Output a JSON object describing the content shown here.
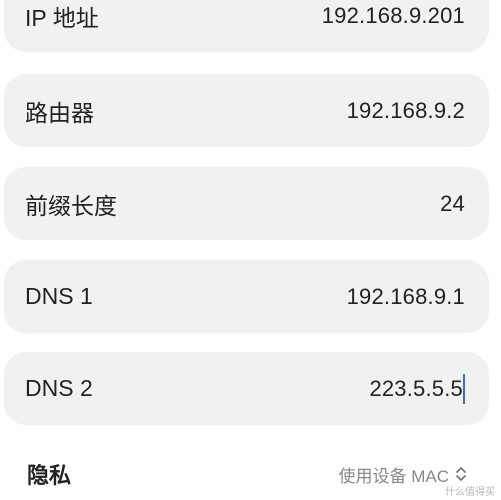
{
  "fields": [
    {
      "label": "IP 地址",
      "value": "192.168.9.201"
    },
    {
      "label": "路由器",
      "value": "192.168.9.2"
    },
    {
      "label": "前缀长度",
      "value": "24"
    },
    {
      "label": "DNS 1",
      "value": "192.168.9.1"
    },
    {
      "label": "DNS 2",
      "value": "223.5.5.5"
    }
  ],
  "privacy": {
    "label": "隐私",
    "selected": "使用设备 MAC",
    "icon": "chevron-up-down-icon"
  },
  "watermark": "什么值得买",
  "colors": {
    "card_bg": "#f1f1f1",
    "cursor": "#2f6fe8",
    "muted": "#888888"
  }
}
